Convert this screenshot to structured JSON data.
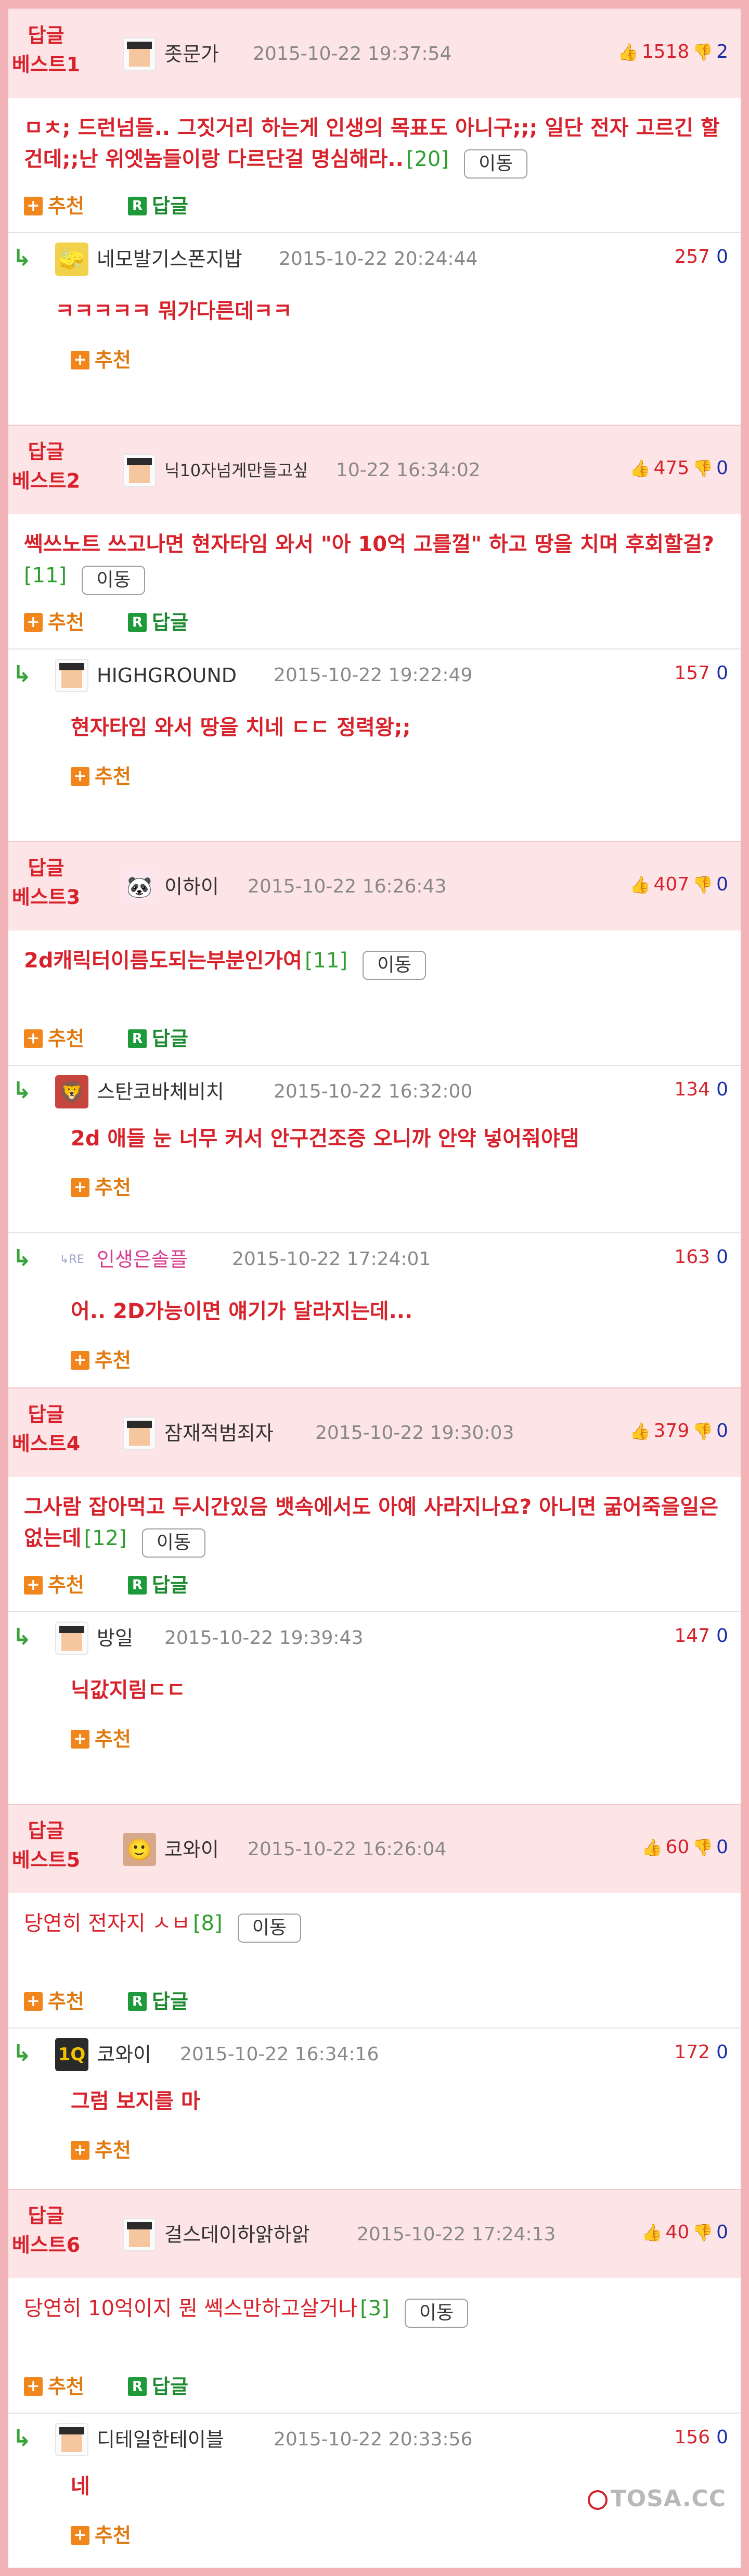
{
  "labels": {
    "recommend": "추천",
    "reply": "답글",
    "move": "이동",
    "best_line1": "답글"
  },
  "watermark": "TOSA.CC",
  "posts": [
    {
      "best_label": "베스트1",
      "user": "좃문가",
      "date": "2015-10-22 19:37:54",
      "up": "1518",
      "down": "2",
      "text": "ㅁㅊ; 드런넘들.. 그짓거리 하는게 인생의 목표도 아니구;;; 일단 전자 고르긴 할건데;;난 위엣놈들이랑 다르단걸 명심해라..",
      "count": "[20]",
      "replies": [
        {
          "user": "네모발기스폰지밥",
          "date": "2015-10-22 20:24:44",
          "votes": "257",
          "zero": "0",
          "text": "ㅋㅋㅋㅋㅋ 뭐가다른데ㅋㅋ"
        }
      ]
    },
    {
      "best_label": "베스트2",
      "user": "닉10자넘게만들고싶",
      "date": "10-22 16:34:02",
      "up": "475",
      "down": "0",
      "text": "쎅쓰노트 쓰고나면 현자타임 와서 \"아 10억 고를껄\" 하고 땅을 치며 후회할걸?",
      "count": "[11]",
      "replies": [
        {
          "user": "HIGHGROUND",
          "date": "2015-10-22 19:22:49",
          "votes": "157",
          "zero": "0",
          "text": "현자타임 와서 땅을 치네 ㄷㄷ 정력왕;;"
        }
      ]
    },
    {
      "best_label": "베스트3",
      "user": "이하이",
      "date": "2015-10-22 16:26:43",
      "up": "407",
      "down": "0",
      "text": "2d캐릭터이름도되는부분인가여",
      "count": "[11]",
      "replies": [
        {
          "user": "스탄코바체비치",
          "date": "2015-10-22 16:32:00",
          "votes": "134",
          "zero": "0",
          "text": "2d 애들 눈 너무 커서 안구건조증 오니까 안약 넣어줘야댐"
        },
        {
          "user": "인생은솔플",
          "date": "2015-10-22 17:24:01",
          "votes": "163",
          "zero": "0",
          "text": "어.. 2D가능이면 얘기가 달라지는데..."
        }
      ]
    },
    {
      "best_label": "베스트4",
      "user": "잠재적범죄자",
      "date": "2015-10-22 19:30:03",
      "up": "379",
      "down": "0",
      "text": "그사람 잡아먹고 두시간있음 뱃속에서도 아예 사라지나요? 아니면 굶어죽을일은 없는데",
      "count": "[12]",
      "replies": [
        {
          "user": "방일",
          "date": "2015-10-22 19:39:43",
          "votes": "147",
          "zero": "0",
          "text": "닉값지림ㄷㄷ"
        }
      ]
    },
    {
      "best_label": "베스트5",
      "user": "코와이",
      "date": "2015-10-22 16:26:04",
      "up": "60",
      "down": "0",
      "text": "당연히 전자지 ㅅㅂ",
      "count": "[8]",
      "replies": [
        {
          "user": "코와이",
          "date": "2015-10-22 16:34:16",
          "votes": "172",
          "zero": "0",
          "text": "그럼 보지를 마"
        }
      ]
    },
    {
      "best_label": "베스트6",
      "user": "걸스데이하앍하앍",
      "date": "2015-10-22 17:24:13",
      "up": "40",
      "down": "0",
      "text": "당연히 10억이지 뭔 쎅스만하고살거나",
      "count": "[3]",
      "replies": [
        {
          "user": "디테일한테이블",
          "date": "2015-10-22 20:33:56",
          "votes": "156",
          "zero": "0",
          "text": "네"
        }
      ]
    }
  ]
}
